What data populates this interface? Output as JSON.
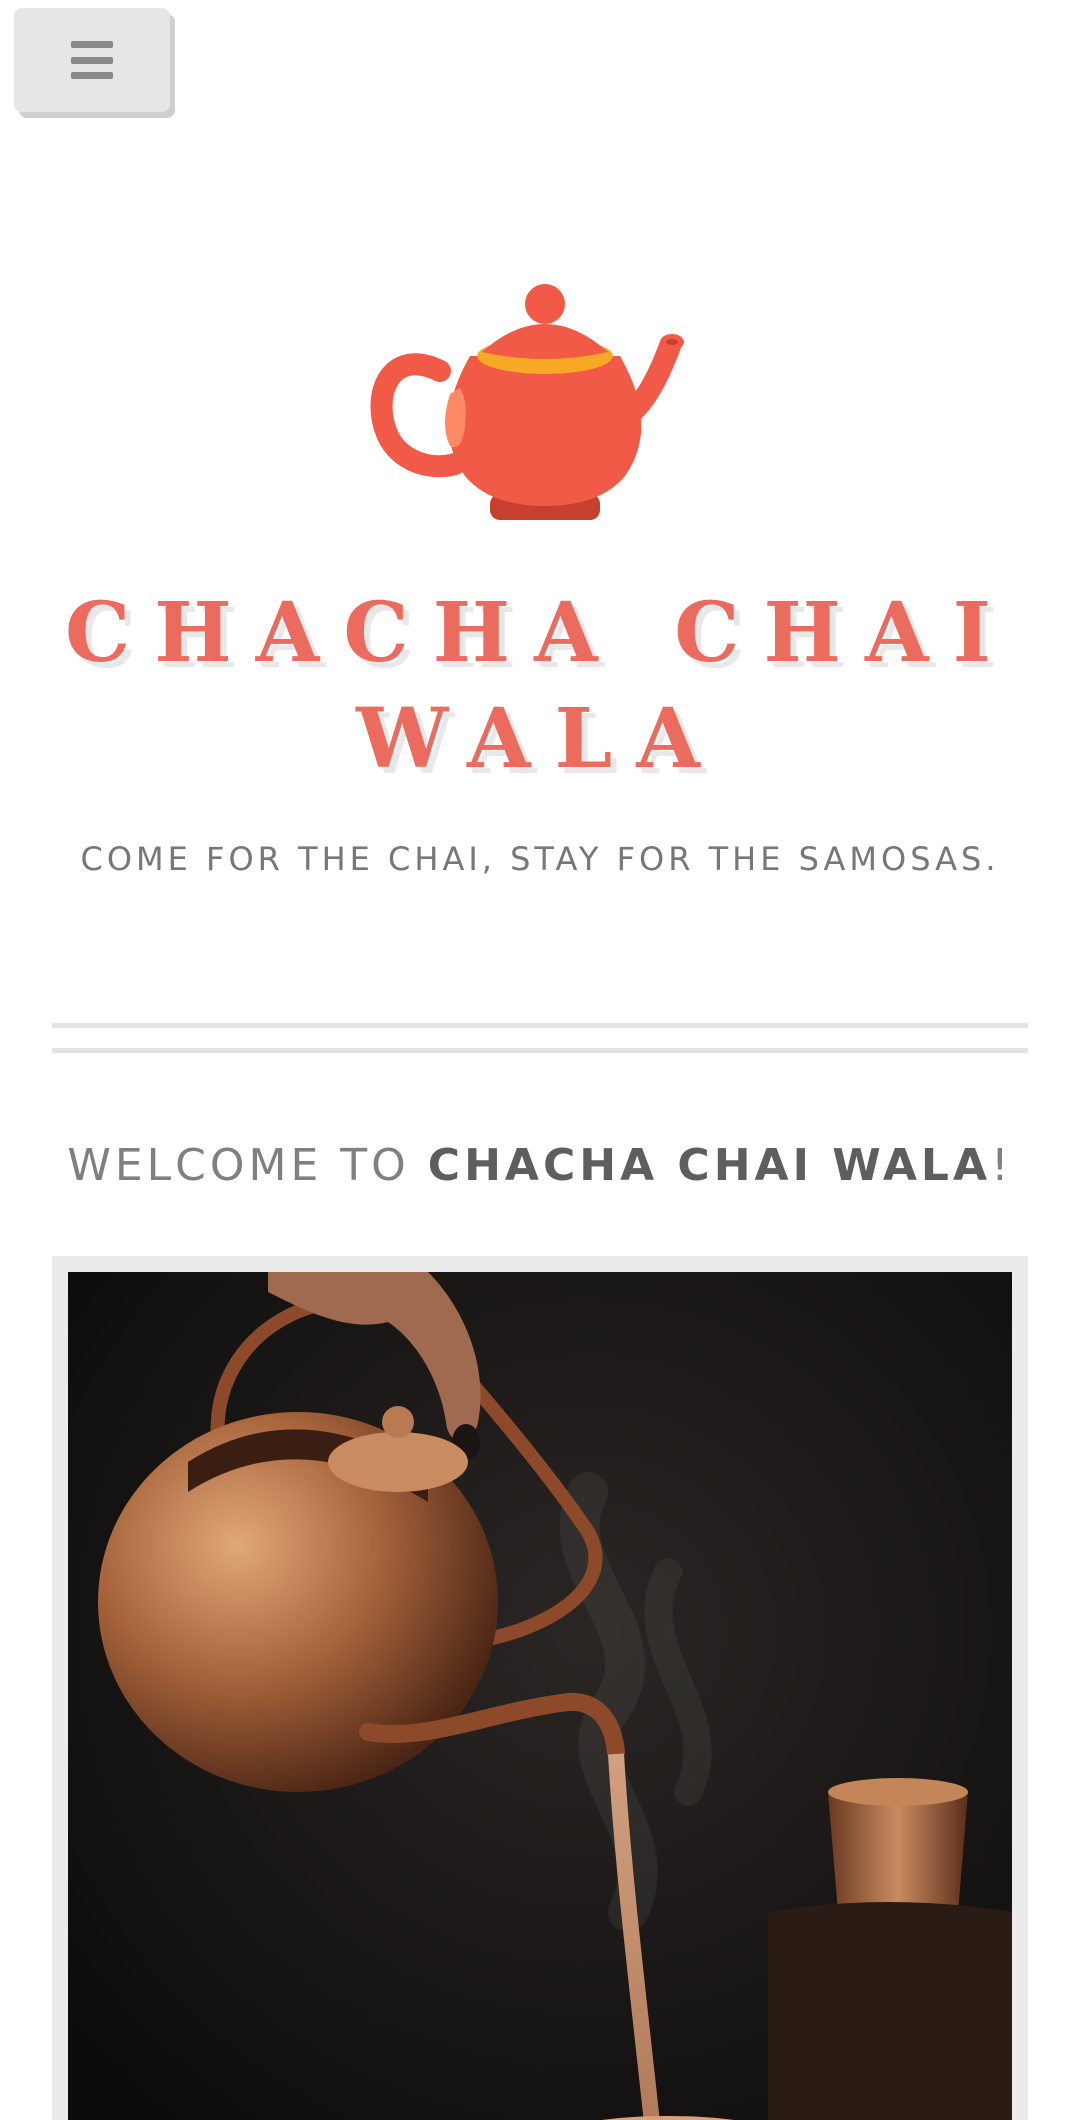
{
  "header": {
    "menu_icon": "hamburger-menu-icon"
  },
  "site": {
    "logo_icon": "teapot-icon",
    "title": "CHACHA CHAI WALA",
    "tagline": "COME FOR THE CHAI, STAY FOR THE SAMOSAS."
  },
  "welcome": {
    "prefix": "WELCOME TO ",
    "brand": "CHACHA CHAI WALA",
    "suffix": "!"
  },
  "colors": {
    "accent": "#ec6b5f",
    "teapot_body": "#f05a46",
    "teapot_band": "#f9a825",
    "text_gray": "#777777"
  },
  "hero_image": {
    "subject": "copper-kettle-pouring-chai-photo"
  }
}
